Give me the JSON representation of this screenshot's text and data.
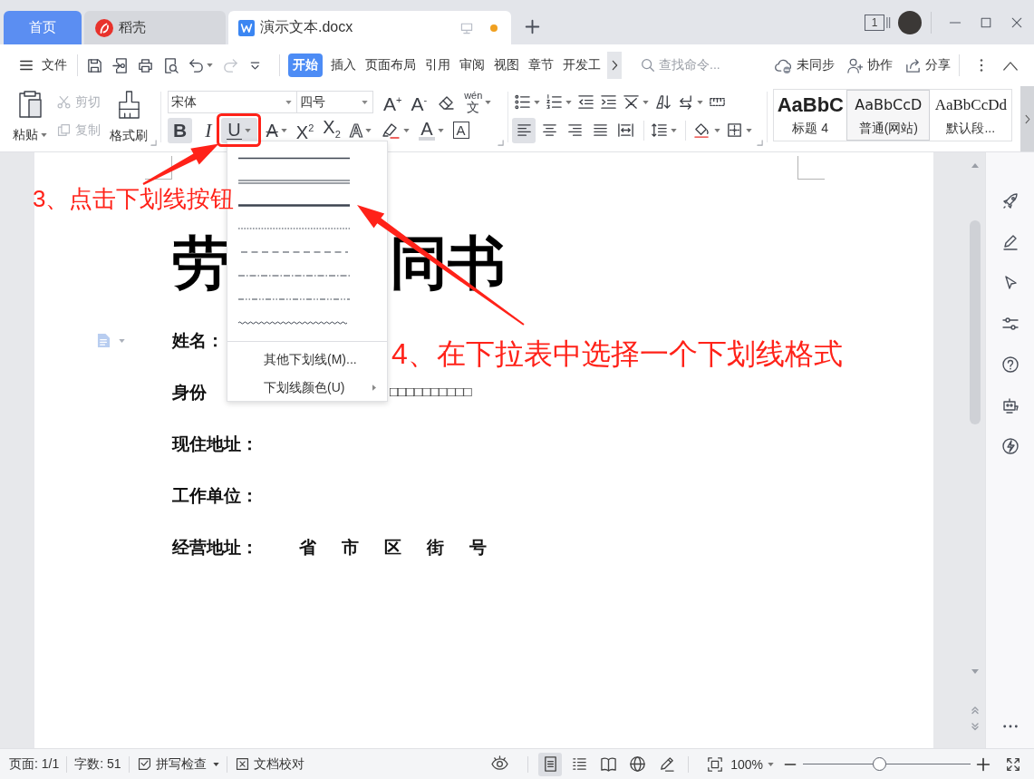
{
  "title_bar": {
    "tabs": [
      {
        "kind": "home",
        "label": "首页",
        "selected": false,
        "modified": false
      },
      {
        "kind": "store",
        "label": "稻壳",
        "selected": false,
        "modified": false
      },
      {
        "kind": "document",
        "label": "演示文本.docx",
        "selected": true,
        "modified": true
      }
    ],
    "window_count": "1"
  },
  "menu_bar": {
    "file_label": "文件",
    "quick_access": [
      {
        "kind": "save",
        "disabled": false
      },
      {
        "kind": "export",
        "disabled": false
      },
      {
        "kind": "print",
        "disabled": false
      },
      {
        "kind": "preview",
        "disabled": false
      },
      {
        "kind": "undo",
        "disabled": false
      },
      {
        "kind": "redo",
        "disabled": true
      }
    ],
    "tabs": [
      {
        "label": "开始",
        "selected": true
      },
      {
        "label": "插入",
        "selected": false
      },
      {
        "label": "页面布局",
        "selected": false
      },
      {
        "label": "引用",
        "selected": false
      },
      {
        "label": "审阅",
        "selected": false
      },
      {
        "label": "视图",
        "selected": false
      },
      {
        "label": "章节",
        "selected": false
      },
      {
        "label": "开发工",
        "selected": false
      }
    ],
    "search": {
      "placeholder": "查找命令..."
    },
    "actions": [
      {
        "kind": "sync",
        "label": "未同步"
      },
      {
        "kind": "collaborate",
        "label": "协作"
      },
      {
        "kind": "share",
        "label": "分享"
      }
    ]
  },
  "ribbon": {
    "clipboard": {
      "paste": "粘贴",
      "cut": {
        "label": "剪切",
        "disabled": true
      },
      "copy": {
        "label": "复制",
        "disabled": true
      },
      "format_painter": "格式刷"
    },
    "font": {
      "name": "宋体",
      "size": "四号",
      "tools": [
        {
          "kind": "grow",
          "label": "A$^{+}$"
        },
        {
          "kind": "shrink",
          "label": "A$^{-}$"
        },
        {
          "kind": "clear"
        },
        {
          "kind": "phonetic",
          "label": "wén",
          "base": "文"
        }
      ],
      "formats": [
        {
          "kind": "bold",
          "label": "B",
          "selected": true
        },
        {
          "kind": "italic",
          "label": "I",
          "selected": false
        },
        {
          "kind": "underline",
          "label": "U",
          "selected": true
        },
        {
          "kind": "strike",
          "label": "A",
          "selected": false
        },
        {
          "kind": "superscript",
          "label": "X$^{2}$",
          "selected": false
        },
        {
          "kind": "subscript",
          "label": "X$_{2}$",
          "selected": false
        },
        {
          "kind": "effect",
          "label": "A",
          "selected": false
        },
        {
          "kind": "highlight",
          "selected": false
        },
        {
          "kind": "color",
          "label": "A",
          "selected": false
        },
        {
          "kind": "border",
          "label": "A",
          "selected": false
        }
      ]
    },
    "paragraph": {
      "alignment": [
        {
          "kind": "left",
          "selected": true
        },
        {
          "kind": "center",
          "selected": false
        },
        {
          "kind": "right",
          "selected": false
        },
        {
          "kind": "justify",
          "selected": false
        },
        {
          "kind": "distribute",
          "selected": false
        }
      ]
    },
    "styles": [
      {
        "kind": "heading",
        "preview": "AaBbC",
        "label": "标题 4",
        "selected": false
      },
      {
        "kind": "web",
        "preview": "AaBbCcD",
        "label": "普通(网站)",
        "selected": true
      },
      {
        "kind": "default",
        "preview": "AaBbCcDd",
        "label": "默认段...",
        "selected": false
      }
    ]
  },
  "underline_menu": {
    "styles": [
      {
        "kind": "single"
      },
      {
        "kind": "double"
      },
      {
        "kind": "thick"
      },
      {
        "kind": "dotted"
      },
      {
        "kind": "dashed"
      },
      {
        "kind": "dash_dot"
      },
      {
        "kind": "dash_dot_dot"
      },
      {
        "kind": "wavy"
      }
    ],
    "items": [
      {
        "label": "其他下划线(M)...",
        "submenu": false
      },
      {
        "label": "下划线颜色(U)",
        "submenu": true
      }
    ]
  },
  "document": {
    "title_parts": [
      "劳",
      "同书"
    ],
    "fields": [
      {
        "label": "姓名：",
        "marker": true
      },
      {
        "label": "身份",
        "value": "□□□□□□□□□□",
        "marker": false
      },
      {
        "label": "现住地址：",
        "marker": false
      },
      {
        "label": "工作单位：",
        "marker": false
      },
      {
        "label": "经营地址：",
        "parts": [
          "省",
          "市",
          "区",
          "街",
          "号"
        ],
        "marker": false
      }
    ]
  },
  "annotations": [
    {
      "kind": "step_3",
      "label": "3、点击下划线按钮"
    },
    {
      "kind": "step_4",
      "label": "4、在下拉表中选择一个下划线格式"
    }
  ],
  "status_bar": {
    "page": "页面: 1/1",
    "words": "字数: 51",
    "spell_check": "拼写检查",
    "proofread": "文档校对",
    "views": [
      {
        "kind": "page",
        "selected": true
      },
      {
        "kind": "outline",
        "selected": false
      },
      {
        "kind": "reading",
        "selected": false
      },
      {
        "kind": "web",
        "selected": false
      },
      {
        "kind": "writing",
        "selected": false
      }
    ],
    "zoom": {
      "value": "100%",
      "level": 0.45
    }
  }
}
